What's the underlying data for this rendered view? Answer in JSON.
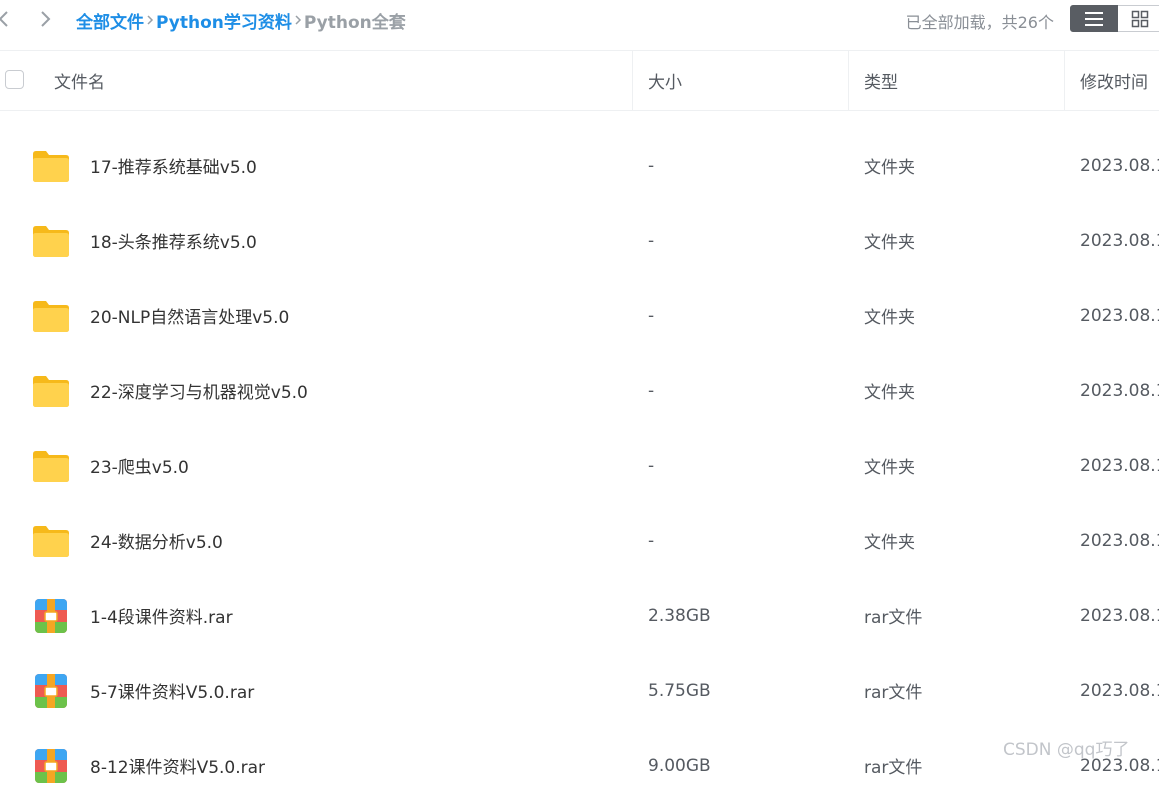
{
  "toolbar": {
    "back_icon": "chevron-left-icon",
    "forward_icon": "chevron-right-icon",
    "breadcrumb": [
      {
        "label": "全部文件",
        "link": true
      },
      {
        "label": "Python学习资料",
        "link": true
      },
      {
        "label": "Python全套",
        "link": false
      }
    ],
    "load_status": "已全部加载，共26个",
    "views": [
      "list-view-icon",
      "grid-view-icon"
    ],
    "active_view": "list"
  },
  "table": {
    "columns": [
      "文件名",
      "大小",
      "类型",
      "修改时间"
    ],
    "rows": [
      {
        "icon": "folder-icon",
        "name": "17-推荐系统基础v5.0",
        "size": "-",
        "type": "文件夹",
        "modified": "2023.08.1"
      },
      {
        "icon": "folder-icon",
        "name": "18-头条推荐系统v5.0",
        "size": "-",
        "type": "文件夹",
        "modified": "2023.08.1"
      },
      {
        "icon": "folder-icon",
        "name": "20-NLP自然语言处理v5.0",
        "size": "-",
        "type": "文件夹",
        "modified": "2023.08.1"
      },
      {
        "icon": "folder-icon",
        "name": "22-深度学习与机器视觉v5.0",
        "size": "-",
        "type": "文件夹",
        "modified": "2023.08.1"
      },
      {
        "icon": "folder-icon",
        "name": "23-爬虫v5.0",
        "size": "-",
        "type": "文件夹",
        "modified": "2023.08.1"
      },
      {
        "icon": "folder-icon",
        "name": "24-数据分析v5.0",
        "size": "-",
        "type": "文件夹",
        "modified": "2023.08.1"
      },
      {
        "icon": "rar-archive-icon",
        "name": "1-4段课件资料.rar",
        "size": "2.38GB",
        "type": "rar文件",
        "modified": "2023.08.1"
      },
      {
        "icon": "rar-archive-icon",
        "name": "5-7课件资料V5.0.rar",
        "size": "5.75GB",
        "type": "rar文件",
        "modified": "2023.08.1"
      },
      {
        "icon": "rar-archive-icon",
        "name": "8-12课件资料V5.0.rar",
        "size": "9.00GB",
        "type": "rar文件",
        "modified": "2023.08.1"
      }
    ]
  },
  "watermark": "CSDN @qq巧了",
  "colors": {
    "link": "#1e8ee6",
    "current_crumb": "#9aa0a6",
    "folder": "#ffc933",
    "active_view_bg": "#595d63"
  }
}
